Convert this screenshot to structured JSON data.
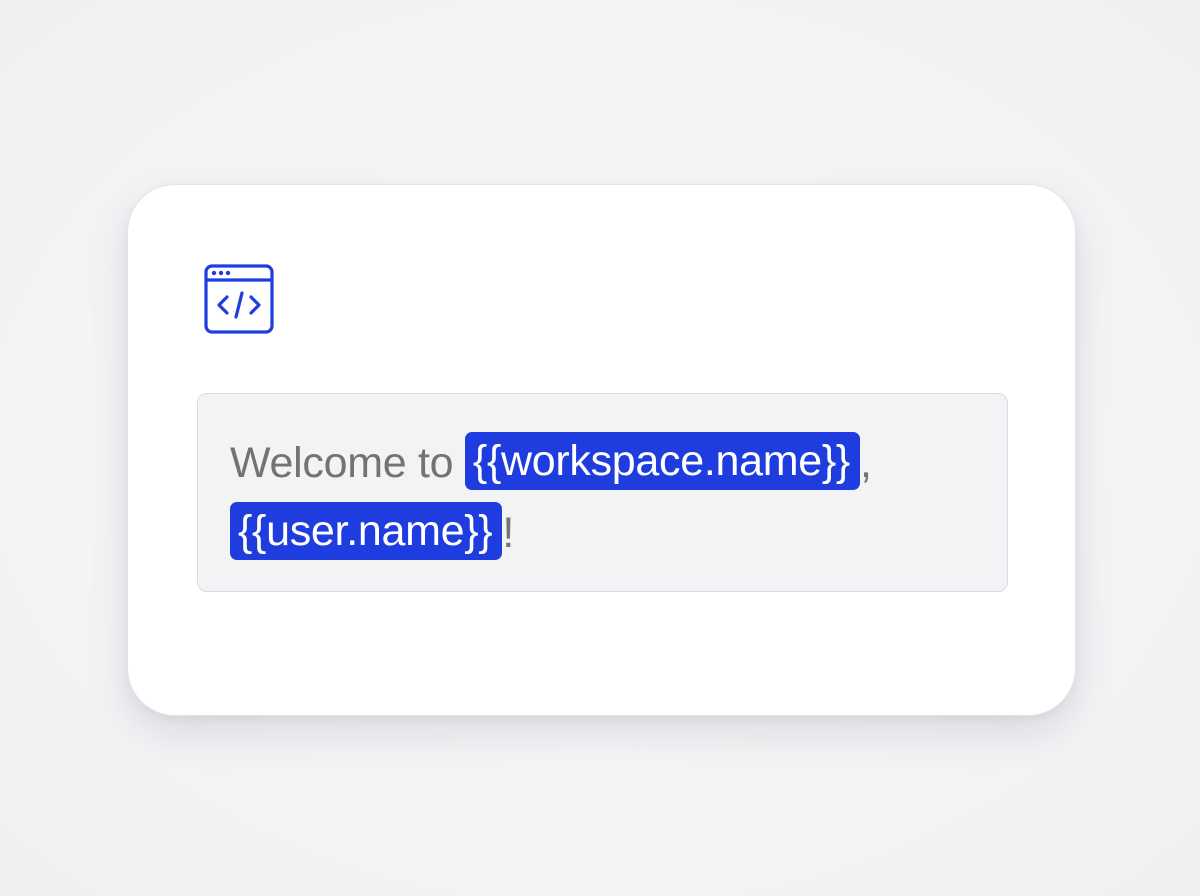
{
  "card": {
    "icon": "code-window-icon",
    "editor": {
      "prefix_text": "Welcome to ",
      "token_workspace": "{{workspace.name}}",
      "comma": ",",
      "token_user": "{{user.name}}",
      "suffix_text": "!"
    }
  },
  "colors": {
    "accent": "#1f3ddf",
    "text": "#737373",
    "card_bg": "#ffffff",
    "editor_bg": "#f2f3f5",
    "page_bg": "#f3f4f6"
  }
}
